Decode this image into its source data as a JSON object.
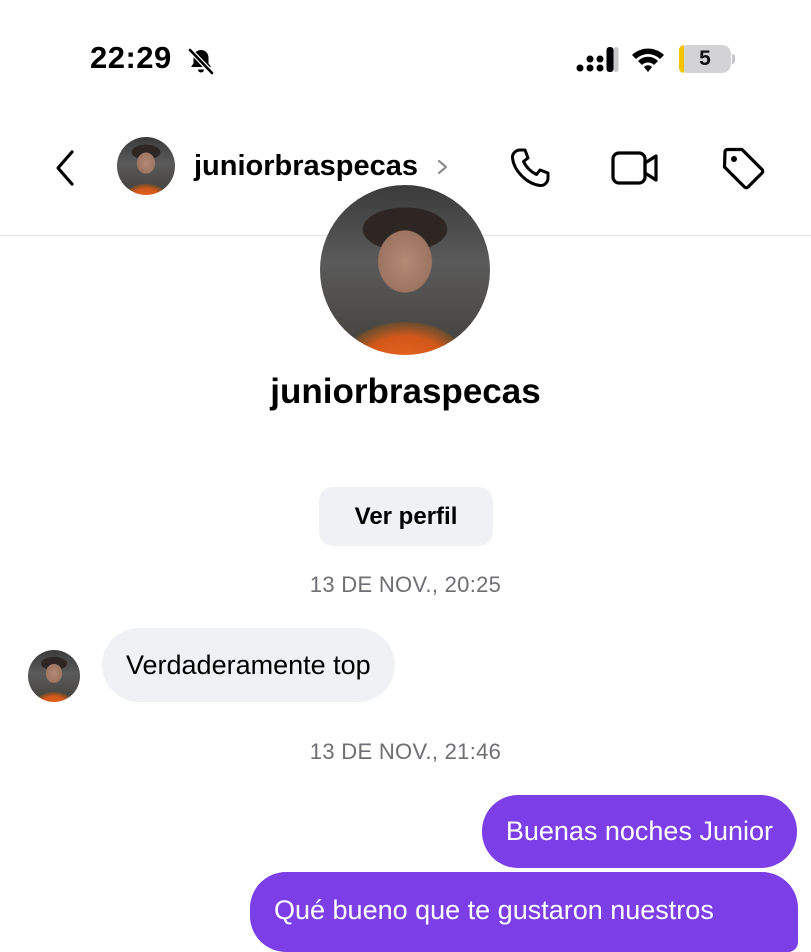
{
  "status_bar": {
    "time": "22:29",
    "battery_level": "5",
    "icons": [
      "bell-muted-icon",
      "cellular-signal-icon",
      "wifi-icon",
      "battery-icon"
    ]
  },
  "header": {
    "username": "juniorbraspecas",
    "icons": [
      "back-chevron-icon",
      "phone-icon",
      "video-camera-icon",
      "tag-icon"
    ]
  },
  "profile": {
    "name": "juniorbraspecas",
    "view_profile_label": "Ver perfil"
  },
  "messages": [
    {
      "timestamp": "13 DE NOV., 20:25"
    },
    {
      "direction": "incoming",
      "text": "Verdaderamente top"
    },
    {
      "timestamp": "13 DE NOV., 21:46"
    },
    {
      "direction": "outgoing",
      "text": "Buenas noches Junior"
    },
    {
      "direction": "outgoing",
      "text": "Qué bueno que te gustaron nuestros"
    }
  ],
  "colors": {
    "outgoing_bubble": "#7c3ee6",
    "incoming_bubble": "#eff1f5",
    "timestamp_text": "#6e6e73"
  }
}
